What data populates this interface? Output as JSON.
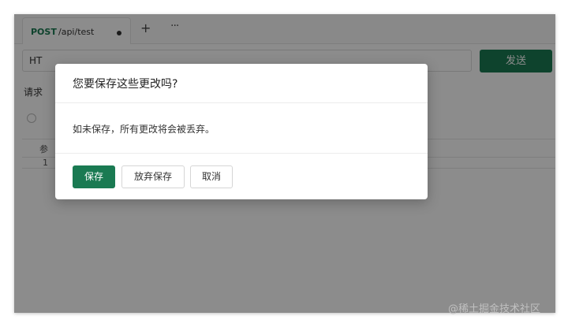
{
  "tabbar": {
    "tab": {
      "method": "POST",
      "path": "/api/test",
      "unsaved_dot": "●"
    },
    "new_tab": "+",
    "more": "···"
  },
  "request": {
    "url_value": "HT",
    "send_label": "发送",
    "section_label": "请求",
    "params_header_label": "参",
    "params_row_label": "1"
  },
  "dialog": {
    "title": "您要保存这些更改吗?",
    "message": "如未保存，所有更改将会被丢弃。",
    "save_label": "保存",
    "discard_label": "放弃保存",
    "cancel_label": "取消"
  },
  "watermark": "@稀土掘金技术社区",
  "colors": {
    "accent": "#1a7a52",
    "overlay": "rgba(0,0,0,0.45)"
  }
}
